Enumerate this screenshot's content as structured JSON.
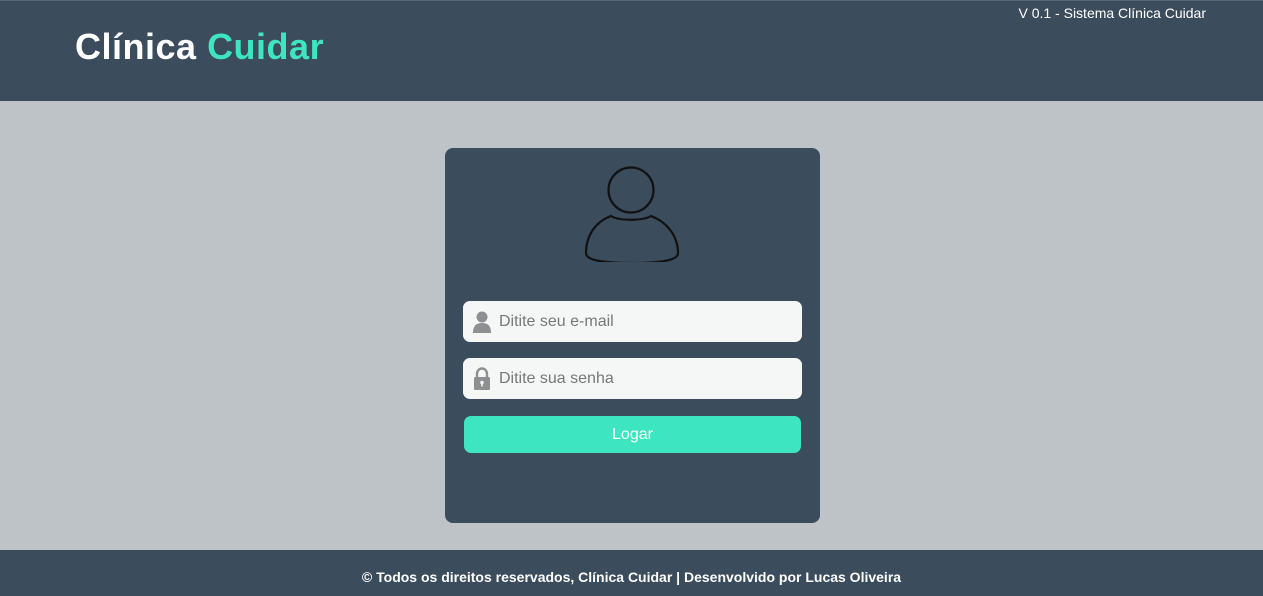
{
  "header": {
    "brand_part1": "Clínica",
    "brand_part2": "Cuidar",
    "version": "V 0.1 - Sistema Clínica Cuidar"
  },
  "login": {
    "avatar_icon": "user-avatar-icon",
    "email": {
      "icon": "user-icon",
      "placeholder": "Ditite seu e-mail",
      "value": ""
    },
    "password": {
      "icon": "lock-icon",
      "placeholder": "Ditite sua senha",
      "value": ""
    },
    "submit_label": "Logar"
  },
  "footer": {
    "text": "© Todos os direitos reservados, Clínica Cuidar | Desenvolvido por Lucas Oliveira"
  },
  "colors": {
    "header_bg": "#3b4c5d",
    "page_bg": "#bec3c7",
    "accent": "#3de6c1",
    "card_bg": "#3b4c5d",
    "input_bg": "#f5f7f7"
  }
}
